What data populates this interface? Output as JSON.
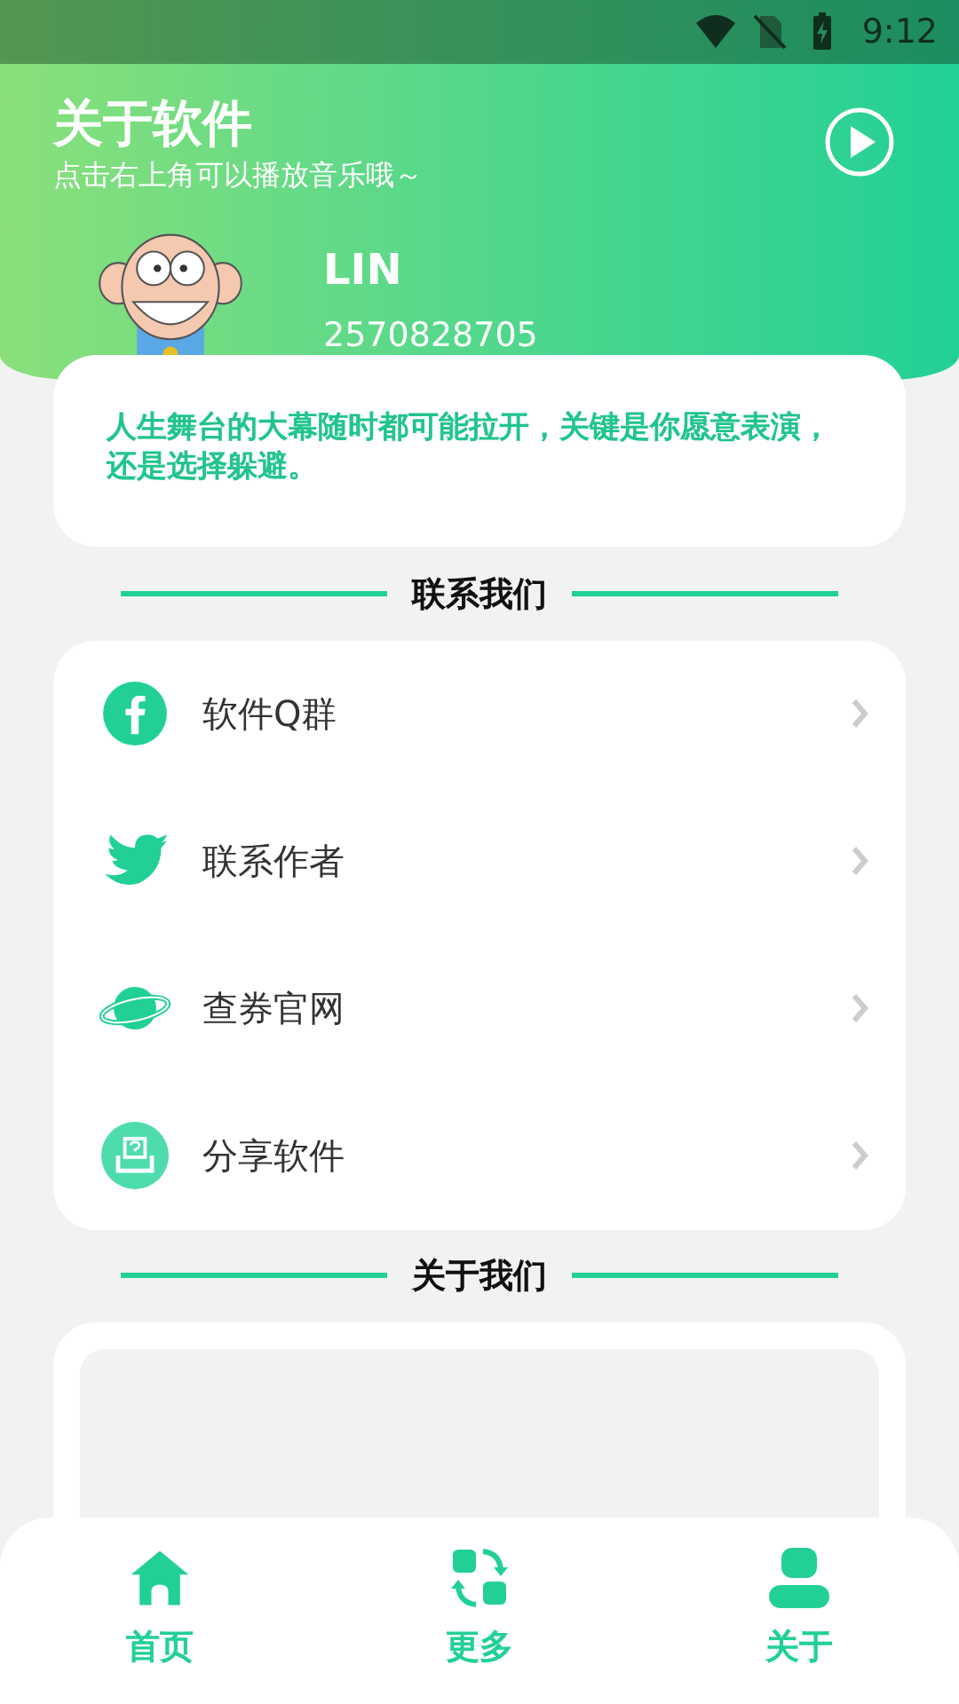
{
  "status_bar": {
    "time": "9:12"
  },
  "header": {
    "title": "关于软件",
    "subtitle": "点击右上角可以播放音乐哦～",
    "user_name": "LIN",
    "user_id": "2570828705"
  },
  "quote": "人生舞台的大幕随时都可能拉开，关键是你愿意表演，还是选择躲避。",
  "contact_section": {
    "title": "联系我们",
    "items": [
      {
        "kind": "facebook",
        "label": "软件Q群"
      },
      {
        "kind": "bird",
        "label": "联系作者"
      },
      {
        "kind": "planet",
        "label": "查券官网"
      },
      {
        "kind": "share",
        "label": "分享软件"
      }
    ]
  },
  "about_section": {
    "title": "关于我们"
  },
  "tab_bar": [
    {
      "kind": "home",
      "label": "首页"
    },
    {
      "kind": "more",
      "label": "更多"
    },
    {
      "kind": "person",
      "label": "关于"
    }
  ]
}
